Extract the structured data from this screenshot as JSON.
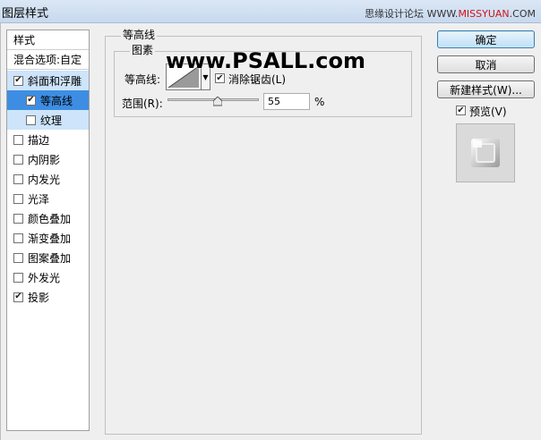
{
  "window": {
    "title": "图层样式"
  },
  "watermark": {
    "site_cn": "思缘设计论坛",
    "site_prefix": "WWW.",
    "site_red": "MISSYUAN",
    "site_suffix": ".COM"
  },
  "overlay_watermark": "www.PSALL.com",
  "style_list": {
    "header": "样式",
    "blend_options": "混合选项:自定",
    "items": [
      {
        "label": "斜面和浮雕",
        "checked": true,
        "state": "selected-light"
      },
      {
        "label": "等高线",
        "checked": true,
        "state": "selected-dark",
        "indent": true
      },
      {
        "label": "纹理",
        "checked": false,
        "state": "selected-light",
        "indent": true
      },
      {
        "label": "描边",
        "checked": false
      },
      {
        "label": "内阴影",
        "checked": false
      },
      {
        "label": "内发光",
        "checked": false
      },
      {
        "label": "光泽",
        "checked": false
      },
      {
        "label": "颜色叠加",
        "checked": false
      },
      {
        "label": "渐变叠加",
        "checked": false
      },
      {
        "label": "图案叠加",
        "checked": false
      },
      {
        "label": "外发光",
        "checked": false
      },
      {
        "label": "投影",
        "checked": true
      }
    ]
  },
  "contour_panel": {
    "section_title": "等高线",
    "group_title": "图素",
    "contour_label": "等高线:",
    "antialias_label": "消除锯齿(L)",
    "antialias_checked": true,
    "range_label": "范围(R):",
    "range_value": "55",
    "range_unit": "%",
    "range_fraction": 0.55
  },
  "buttons": {
    "ok": "确定",
    "cancel": "取消",
    "new_style": "新建样式(W)...",
    "preview_label": "预览(V)",
    "preview_checked": true
  },
  "colors": {
    "selected_dark": "#3d8ee3",
    "selected_light": "#cde4fb",
    "watermark_red": "#d0141b"
  }
}
